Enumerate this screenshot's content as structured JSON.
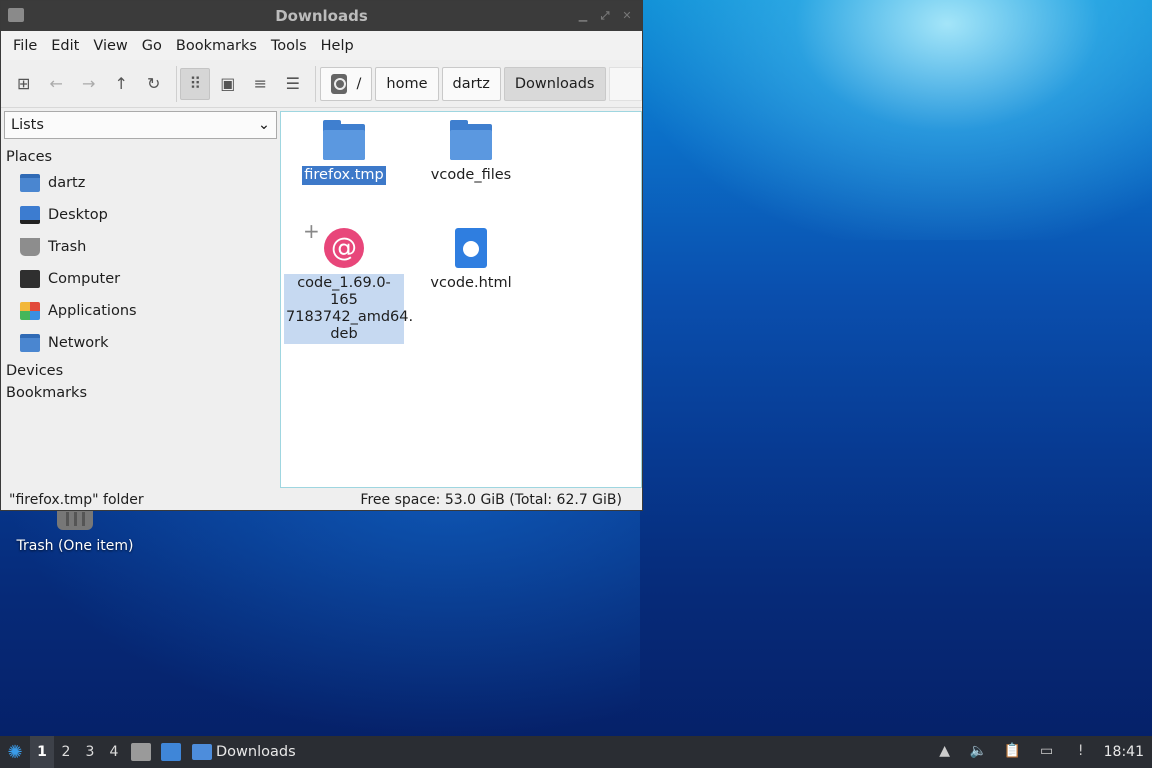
{
  "window": {
    "title": "Downloads",
    "menu": [
      "File",
      "Edit",
      "View",
      "Go",
      "Bookmarks",
      "Tools",
      "Help"
    ],
    "breadcrumbs": [
      "/",
      "home",
      "dartz",
      "Downloads"
    ]
  },
  "sidebar": {
    "dropdown_value": "Lists",
    "sections": {
      "places": "Places",
      "devices": "Devices",
      "bookmarks": "Bookmarks"
    },
    "places": [
      "dartz",
      "Desktop",
      "Trash",
      "Computer",
      "Applications",
      "Network"
    ]
  },
  "files": [
    {
      "name": "firefox.tmp",
      "type": "folder-icon"
    },
    {
      "name": "vcode_files",
      "type": "folder-icon"
    },
    {
      "name": "code_1.69.0-1657183742_amd64.deb",
      "line1": "code_1.69.0-165",
      "line2": "7183742_amd64.",
      "line3": "deb",
      "type": "debian-package-icon"
    },
    {
      "name": "vcode.html",
      "type": "html-file-icon"
    }
  ],
  "status": {
    "left": "\"firefox.tmp\" folder",
    "right": "Free space: 53.0 GiB (Total: 62.7 GiB)"
  },
  "desktop": {
    "trash_label": "Trash (One item)"
  },
  "taskbar": {
    "workspaces": [
      "1",
      "2",
      "3",
      "4"
    ],
    "window_label": "Downloads",
    "clock": "18:41"
  }
}
